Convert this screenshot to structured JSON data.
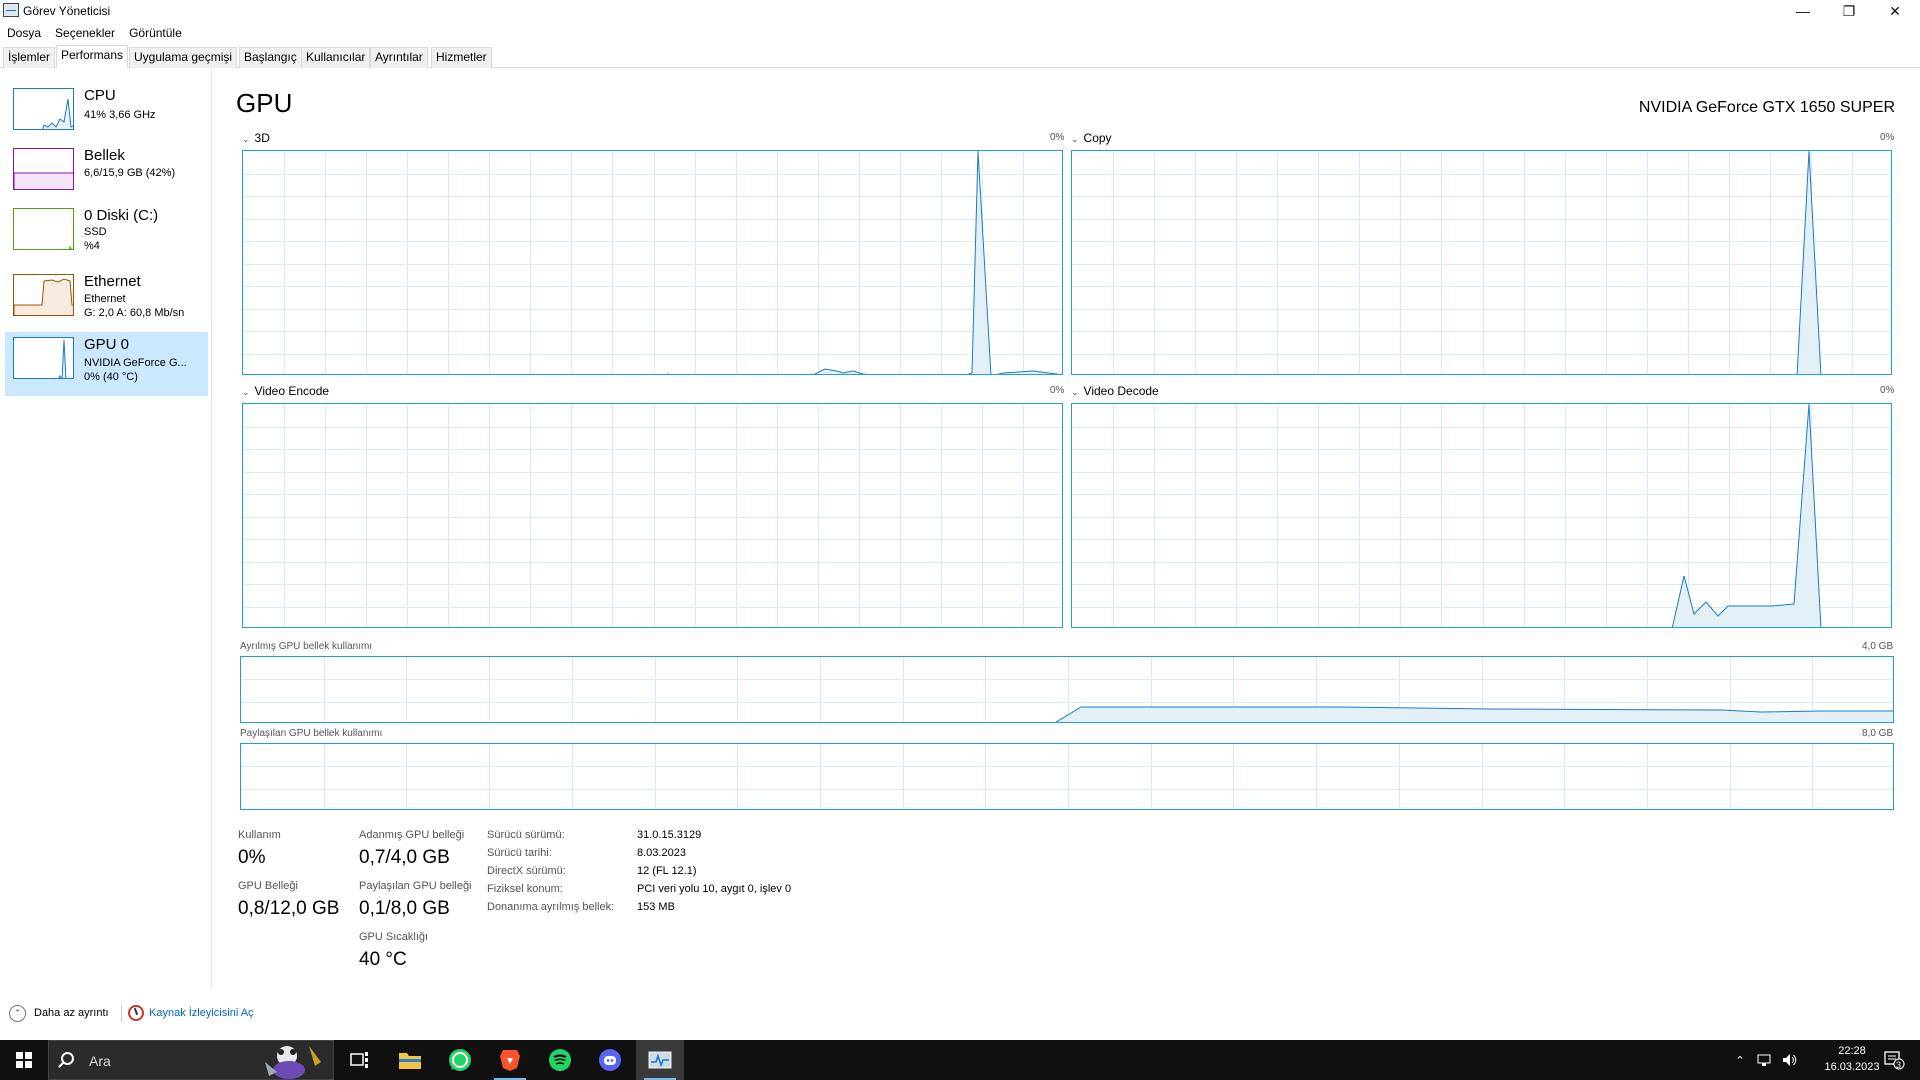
{
  "window": {
    "title": "Görev Yöneticisi"
  },
  "menu": [
    "Dosya",
    "Seçenekler",
    "Görüntüle"
  ],
  "tabs": [
    "İşlemler",
    "Performans",
    "Uygulama geçmişi",
    "Başlangıç",
    "Kullanıcılar",
    "Ayrıntılar",
    "Hizmetler"
  ],
  "active_tab": "Performans",
  "sidebar": {
    "items": [
      {
        "name": "CPU",
        "sub1": "41%  3,66 GHz",
        "sub2": "",
        "color": "#1a7bc7"
      },
      {
        "name": "Bellek",
        "sub1": "6,6/15,9 GB (42%)",
        "sub2": "",
        "color": "#8b12ae"
      },
      {
        "name": "0 Diski (C:)",
        "sub1": "SSD",
        "sub2": "%4",
        "color": "#4da60c"
      },
      {
        "name": "Ethernet",
        "sub1": "Ethernet",
        "sub2": "G: 2,0  A: 60,8 Mb/sn",
        "color": "#a74f01"
      },
      {
        "name": "GPU 0",
        "sub1": "NVIDIA GeForce G...",
        "sub2": "0% (40 °C)",
        "color": "#1a7bc7"
      }
    ]
  },
  "main": {
    "title": "GPU",
    "model": "NVIDIA GeForce GTX 1650 SUPER",
    "engines": [
      {
        "label": "3D",
        "pct": "0%"
      },
      {
        "label": "Copy",
        "pct": "0%"
      },
      {
        "label": "Video Encode",
        "pct": "0%"
      },
      {
        "label": "Video Decode",
        "pct": "0%"
      }
    ],
    "dedicated_mem": {
      "label": "Ayrılmış GPU bellek kullanımı",
      "max": "4,0 GB"
    },
    "shared_mem": {
      "label": "Paylaşılan GPU bellek kullanımı",
      "max": "8,0 GB"
    }
  },
  "stats": {
    "utilization_label": "Kullanım",
    "utilization_value": "0%",
    "dedicated_label": "Adanmış GPU belleği",
    "dedicated_value": "0,7/4,0 GB",
    "gpu_mem_label": "GPU Belleği",
    "gpu_mem_value": "0,8/12,0 GB",
    "shared_label": "Paylaşılan GPU belleği",
    "shared_value": "0,1/8,0 GB",
    "temp_label": "GPU Sıcaklığı",
    "temp_value": "40 °C"
  },
  "info": [
    {
      "key": "Sürücü sürümü:",
      "value": "31.0.15.3129"
    },
    {
      "key": "Sürücü tarihi:",
      "value": "8.03.2023"
    },
    {
      "key": "DirectX sürümü:",
      "value": "12 (FL 12.1)"
    },
    {
      "key": "Fiziksel konum:",
      "value": "PCI veri yolu 10, aygıt 0, işlev 0"
    },
    {
      "key": "Donanıma ayrılmış bellek:",
      "value": "153 MB"
    }
  ],
  "footer": {
    "less_detail": "Daha az ayrıntı",
    "resource_monitor": "Kaynak İzleyicisini Aç"
  },
  "taskbar": {
    "search_placeholder": "Ara",
    "apps": [
      "task-view",
      "file-explorer",
      "whatsapp",
      "brave",
      "spotify",
      "discord",
      "task-manager"
    ],
    "time": "22:28",
    "date": "16.03.2023",
    "notification_count": "3"
  }
}
